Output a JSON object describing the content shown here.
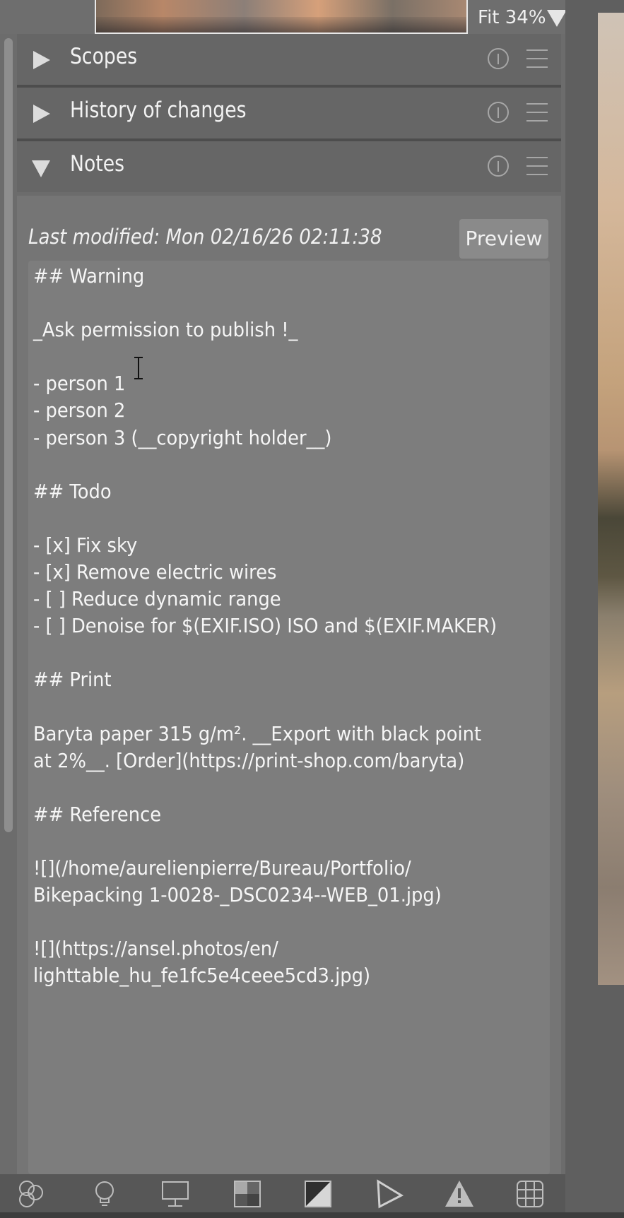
{
  "zoom": {
    "label": "Fit 34%"
  },
  "sections": [
    {
      "title": "Scopes",
      "expanded": false
    },
    {
      "title": "History of changes",
      "expanded": false
    },
    {
      "title": "Notes",
      "expanded": true
    }
  ],
  "notes": {
    "last_modified": "Last modified: Mon 02/16/26 02:11:38",
    "preview_label": "Preview",
    "content": "## Warning\n\n_Ask permission to publish !_\n\n- person 1\n- person 2\n- person 3 (__copyright holder__)\n\n## Todo\n\n- [x] Fix sky\n- [x] Remove electric wires\n- [ ] Reduce dynamic range\n- [ ] Denoise for $(EXIF.ISO) ISO and $(EXIF.MAKER)\n\n## Print\n\nBaryta paper 315 g/m². __Export with black point\nat 2%__. [Order](https://print-shop.com/baryta)\n\n## Reference\n\n![](/home/aurelienpierre/Bureau/Portfolio/\nBikepacking 1-0028-_DSC0234--WEB_01.jpg)\n\n![](https://ansel.photos/en/\nlighttable_hu_fe1fc5e4ceee5cd3.jpg)"
  },
  "toolbar_icons": [
    "color-circles-icon",
    "lightbulb-icon",
    "monitor-icon",
    "checkerboard-icon",
    "contrast-icon",
    "gamut-triangle-icon",
    "warning-icon",
    "grid-icon"
  ]
}
